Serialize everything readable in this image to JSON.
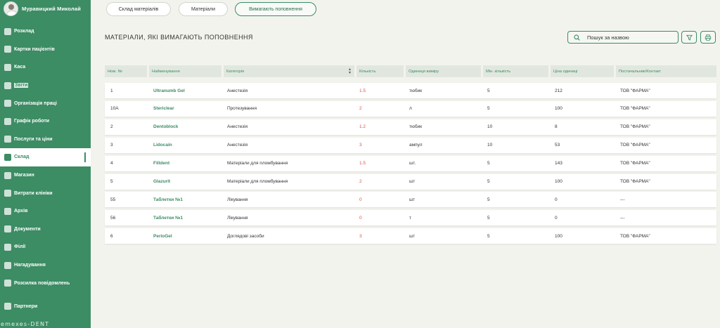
{
  "user": {
    "name": "Муравицкий Миколай"
  },
  "sidebar": {
    "items": [
      {
        "label": "Розклад",
        "icon": "calendar-icon"
      },
      {
        "label": "Картки пацієнтів",
        "icon": "patients-icon"
      },
      {
        "label": "Каса",
        "icon": "cash-icon"
      },
      {
        "label": "Звіти",
        "icon": "reports-icon"
      },
      {
        "label": "Організація праці",
        "icon": "tasks-icon"
      },
      {
        "label": "Графік роботи",
        "icon": "schedule-icon"
      },
      {
        "label": "Послуги та ціни",
        "icon": "services-icon"
      },
      {
        "label": "Склад",
        "icon": "cart-icon"
      },
      {
        "label": "Магазин",
        "icon": "shop-icon"
      },
      {
        "label": "Витрати клініки",
        "icon": "expenses-icon"
      },
      {
        "label": "Архів",
        "icon": "archive-icon"
      },
      {
        "label": "Документи",
        "icon": "documents-icon"
      },
      {
        "label": "Філії",
        "icon": "branches-icon"
      },
      {
        "label": "Нагадування",
        "icon": "reminders-icon"
      },
      {
        "label": "Розсилка повідомлень",
        "icon": "mailing-icon"
      }
    ],
    "active_index": 7,
    "partners": "Партнери",
    "logo": "emexes-DENT"
  },
  "tabs": [
    {
      "label": "Склад матеріалів"
    },
    {
      "label": "Матеріали"
    },
    {
      "label": "Вимагають поповнення"
    }
  ],
  "active_tab": 2,
  "page": {
    "title": "МАТЕРІАЛИ, ЯКІ ВИМАГАЮТЬ ПОПОВНЕННЯ",
    "search_placeholder": "Пошук за назвою"
  },
  "table": {
    "columns": [
      "Ном. №",
      "Найменування",
      "Категорія",
      "Кількість",
      "Одиниця виміру",
      "Мін. кількість",
      "Ціна одиниці",
      "Постачальник/Контакт"
    ],
    "rows": [
      [
        "1",
        "Ultranumb Gel",
        "Анестезія",
        "1.5",
        "тюбик",
        "5",
        "212",
        "ТОВ \"ФАРМА\""
      ],
      [
        "10А",
        "Stericlear",
        "Протезування",
        "2",
        "л",
        "5",
        "100",
        "ТОВ \"ФАРМА\""
      ],
      [
        "2",
        "Dentoblock",
        "Анестезія",
        "1.2",
        "тюбик",
        "10",
        "8",
        "ТОВ \"ФАРМА\""
      ],
      [
        "3",
        "Lidocain",
        "Анестезія",
        "3",
        "ампул",
        "10",
        "53",
        "ТОВ \"ФАРМА\""
      ],
      [
        "4",
        "Filldent",
        "Матеріали для пломбування",
        "1.5",
        "шт.",
        "5",
        "143",
        "ТОВ \"ФАРМА\""
      ],
      [
        "5",
        "Glazurit",
        "Матеріали для пломбування",
        "2",
        "шт",
        "5",
        "100",
        "ТОВ \"ФАРМА\""
      ],
      [
        "55",
        "Таблетки №1",
        "Лікування",
        "0",
        "шт",
        "5",
        "0",
        "---"
      ],
      [
        "56",
        "Таблетки №1",
        "Лікування",
        "0",
        "т",
        "5",
        "0",
        "---"
      ],
      [
        "6",
        "PerioGel",
        "Доглядові засоби",
        "3",
        "шт",
        "5",
        "100",
        "ТОВ \"ФАРМА\""
      ]
    ]
  },
  "colors": {
    "accent": "#3c8c64",
    "quantity": "#d9534f"
  }
}
